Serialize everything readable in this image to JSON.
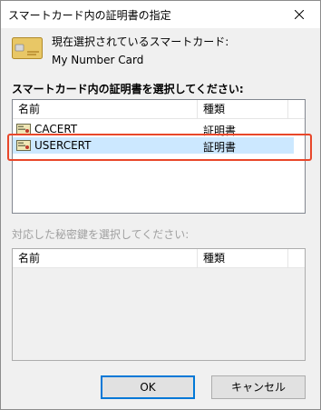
{
  "window": {
    "title": "スマートカード内の証明書の指定",
    "close_icon": "close-icon"
  },
  "current_card": {
    "icon": "smart-card-icon",
    "label": "現在選択されているスマートカード:",
    "value": "My Number Card"
  },
  "cert_section": {
    "label": "スマートカード内の証明書を選択してください:",
    "columns": [
      "名前",
      "種類"
    ],
    "rows": [
      {
        "name": "CACERT",
        "type": "証明書",
        "icon": "certificate-icon",
        "selected": false
      },
      {
        "name": "USERCERT",
        "type": "証明書",
        "icon": "certificate-icon",
        "selected": true
      }
    ]
  },
  "key_section": {
    "label": "対応した秘密鍵を選択してください:",
    "columns": [
      "名前",
      "種類"
    ],
    "rows": []
  },
  "buttons": {
    "ok_label": "OK",
    "cancel_label": "キャンセル"
  },
  "colors": {
    "selection": "#cce8ff",
    "highlight": "#e8472a",
    "accent": "#0078d7"
  }
}
